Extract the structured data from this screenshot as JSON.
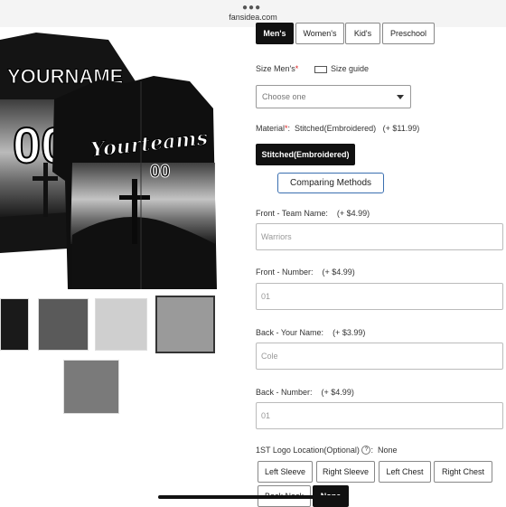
{
  "browser": {
    "url": "fansidea.com"
  },
  "gallery": {
    "front_name": "YOURNAME",
    "front_number": "00",
    "back_script": "Yourteams",
    "back_number": "00",
    "thumbnails": [
      "thumb-front-back",
      "thumb-gray",
      "thumb-detail",
      "thumb-pattern",
      "thumb-fonts"
    ]
  },
  "size_tabs": [
    "Men's",
    "Women's",
    "Kid's",
    "Preschool"
  ],
  "size": {
    "label": "Size Men's",
    "guide": "Size guide",
    "placeholder": "Choose one"
  },
  "material": {
    "label": "Material",
    "value": "Stitched(Embroidered)",
    "price": "(+ $11.99)",
    "option": "Stitched(Embroidered)",
    "compare": "Comparing Methods"
  },
  "fields": [
    {
      "label": "Front - Team Name:",
      "price": "(+ $4.99)",
      "placeholder": "Warriors"
    },
    {
      "label": "Front - Number:",
      "price": "(+ $4.99)",
      "placeholder": "01"
    },
    {
      "label": "Back - Your Name:",
      "price": "(+ $3.99)",
      "placeholder": "Cole"
    },
    {
      "label": "Back - Number:",
      "price": "(+ $4.99)",
      "placeholder": "01"
    }
  ],
  "logo": {
    "label": "1ST Logo Location(Optional)",
    "value": "None",
    "options": [
      "Left Sleeve",
      "Right Sleeve",
      "Left Chest",
      "Right Chest",
      "Back Neck",
      "None"
    ]
  }
}
